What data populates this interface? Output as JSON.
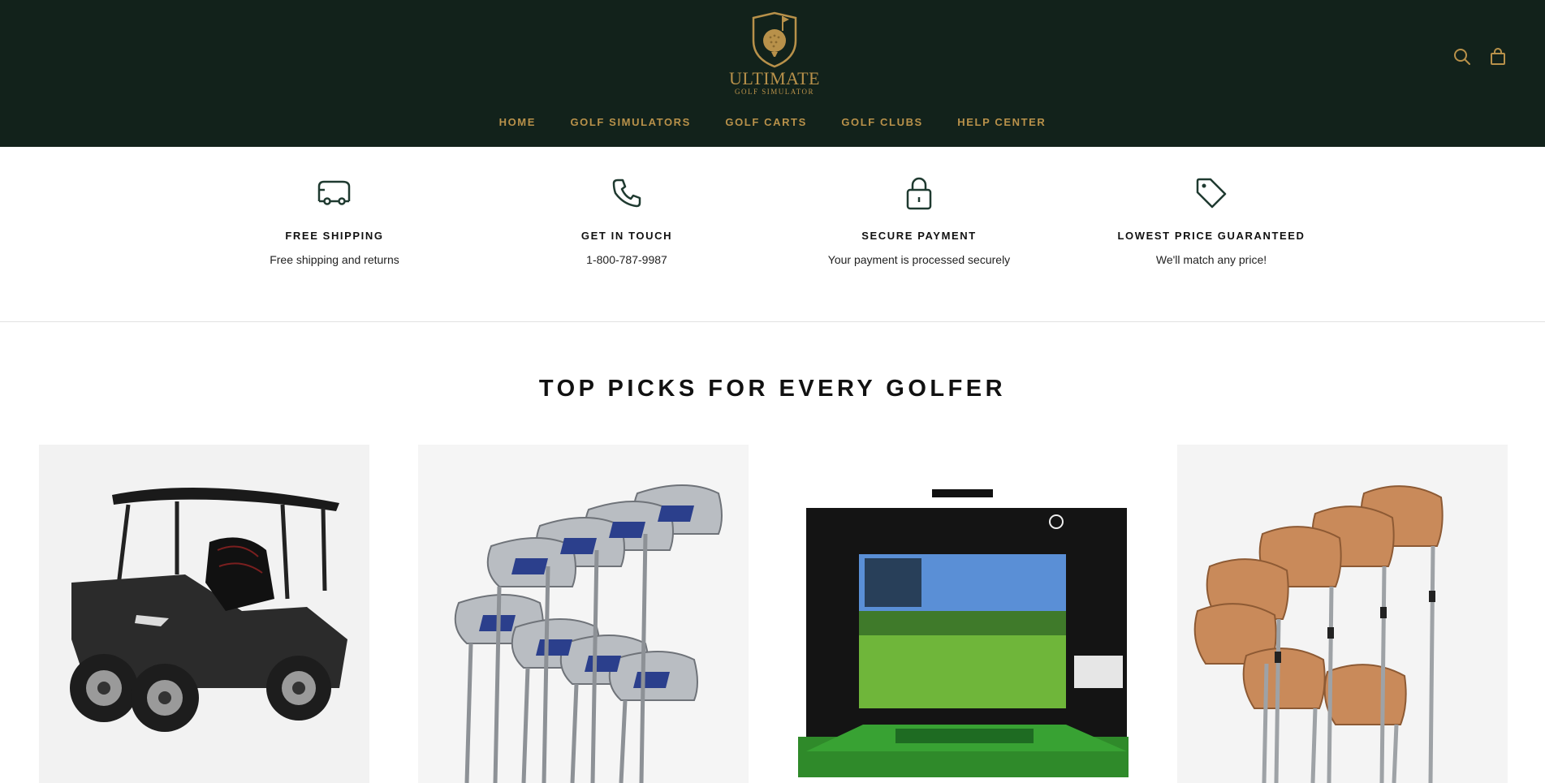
{
  "brand": {
    "title": "ULTIMATE",
    "subtitle": "GOLF SIMULATOR"
  },
  "nav": [
    "HOME",
    "GOLF SIMULATORS",
    "GOLF CARTS",
    "GOLF CLUBS",
    "HELP CENTER"
  ],
  "header_icons": [
    "search-icon",
    "bag-icon"
  ],
  "features": [
    {
      "icon": "truck-icon",
      "title": "FREE SHIPPING",
      "desc": "Free shipping and returns"
    },
    {
      "icon": "phone-icon",
      "title": "GET IN TOUCH",
      "desc": "1-800-787-9987"
    },
    {
      "icon": "lock-icon",
      "title": "SECURE PAYMENT",
      "desc": "Your payment is processed securely"
    },
    {
      "icon": "tag-icon",
      "title": "LOWEST PRICE GUARANTEED",
      "desc": "We'll match any price!"
    }
  ],
  "section_title": "TOP PICKS FOR EVERY GOLFER",
  "products": [
    {
      "image": "golf-cart"
    },
    {
      "image": "silver-blue-iron-set"
    },
    {
      "image": "golf-simulator-enclosure"
    },
    {
      "image": "copper-iron-set"
    }
  ],
  "colors": {
    "header_bg": "#12221b",
    "gold": "#b8914a",
    "icon_green": "#1f3a30"
  }
}
